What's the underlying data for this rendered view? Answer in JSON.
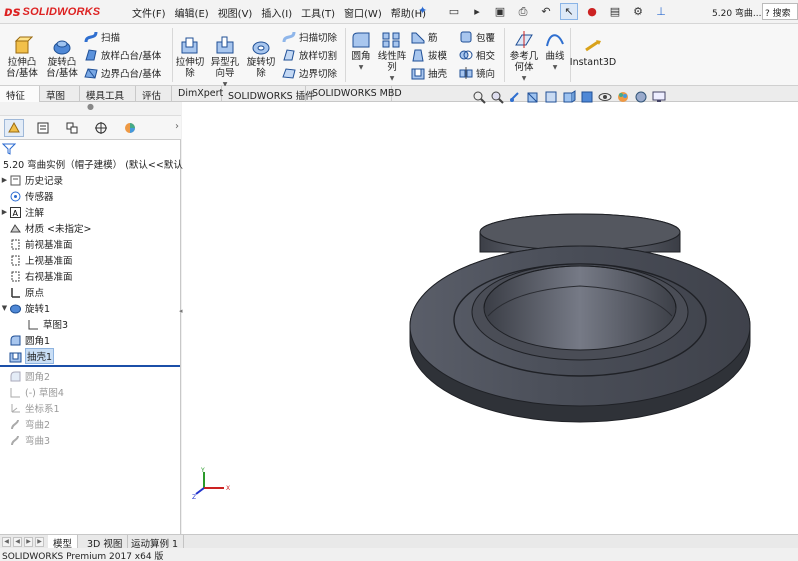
{
  "app": {
    "logo": "SOLIDWORKS",
    "doc_title": "5.20 弯曲...",
    "search_label": "搜索"
  },
  "menu": [
    "文件(F)",
    "编辑(E)",
    "视图(V)",
    "插入(I)",
    "工具(T)",
    "窗口(W)",
    "帮助(H)"
  ],
  "ribbon": {
    "extrude_boss": "拉伸凸\n台/基体",
    "revolve_boss": "旋转凸\n台/基体",
    "sweep": "扫描",
    "loft": "放样凸台/基体",
    "boundary_boss": "边界凸台/基体",
    "extrude_cut": "拉伸切\n除",
    "hole_wizard": "异型孔\n向导",
    "revolve_cut": "旋转切\n除",
    "swept_cut": "扫描切除",
    "lofted_cut": "放样切割",
    "boundary_cut": "边界切除",
    "fillet": "圆角",
    "linear_pattern": "线性阵\n列",
    "rib": "筋",
    "draft": "拔模",
    "shell": "抽壳",
    "wrap": "包覆",
    "intersect": "相交",
    "mirror": "镜向",
    "ref_geometry": "参考几\n何体",
    "curves": "曲线",
    "instant3d": "Instant3D"
  },
  "command_tabs": [
    "特征",
    "草图",
    "模具工具",
    "评估",
    "DimXpert",
    "SOLIDWORKS 插件",
    "SOLIDWORKS MBD"
  ],
  "active_command_tab": "特征",
  "tree": {
    "root": "5.20 弯曲实例（帽子建模） (默认<<默认",
    "items": [
      {
        "label": "历史记录",
        "icon": "history-icon",
        "state": "normal"
      },
      {
        "label": "传感器",
        "icon": "sensor-icon",
        "state": "normal"
      },
      {
        "label": "注解",
        "icon": "annotation-icon",
        "state": "normal"
      },
      {
        "label": "材质 <未指定>",
        "icon": "material-icon",
        "state": "normal"
      },
      {
        "label": "前视基准面",
        "icon": "plane-icon",
        "state": "normal"
      },
      {
        "label": "上视基准面",
        "icon": "plane-icon",
        "state": "normal"
      },
      {
        "label": "右视基准面",
        "icon": "plane-icon",
        "state": "normal"
      },
      {
        "label": "原点",
        "icon": "origin-icon",
        "state": "normal"
      },
      {
        "label": "旋转1",
        "icon": "revolve-feature-icon",
        "state": "normal"
      },
      {
        "label": "草图3",
        "icon": "sketch-icon",
        "state": "child"
      },
      {
        "label": "圆角1",
        "icon": "fillet-feature-icon",
        "state": "normal"
      },
      {
        "label": "抽壳1",
        "icon": "shell-feature-icon",
        "state": "selected"
      },
      {
        "label": "圆角2",
        "icon": "fillet-feature-icon",
        "state": "suppressed"
      },
      {
        "label": "(-) 草图4",
        "icon": "sketch-icon",
        "state": "suppressed"
      },
      {
        "label": "坐标系1",
        "icon": "coordinate-system-icon",
        "state": "suppressed"
      },
      {
        "label": "弯曲2",
        "icon": "flex-feature-icon",
        "state": "suppressed"
      },
      {
        "label": "弯曲3",
        "icon": "flex-feature-icon",
        "state": "suppressed"
      }
    ]
  },
  "bottom_tabs": [
    "模型",
    "3D 视图",
    "运动算例 1"
  ],
  "active_bottom_tab": "模型",
  "status": "SOLIDWORKS Premium 2017 x64 版",
  "triad": {
    "x": "X",
    "y": "Y",
    "z": "Z"
  },
  "colors": {
    "brand_red": "#d22222",
    "model": "#4b4f5a",
    "selection": "#c9def5",
    "rollback": "#1b4fa8"
  }
}
